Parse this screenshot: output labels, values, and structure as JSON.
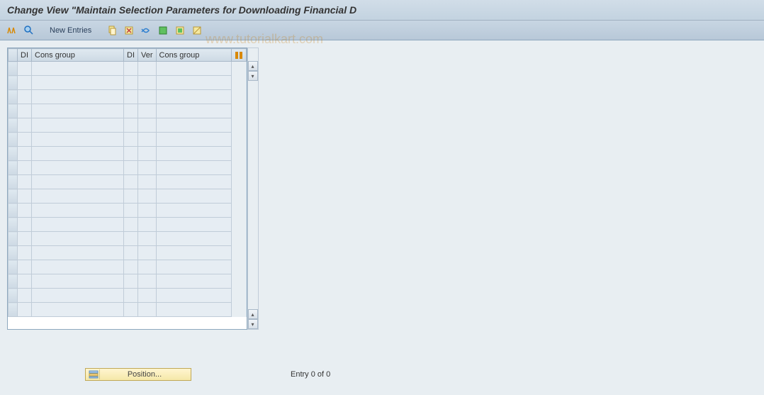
{
  "title": "Change View \"Maintain Selection Parameters for Downloading Financial D",
  "toolbar": {
    "new_entries": "New Entries"
  },
  "table": {
    "headers": {
      "di1": "DI",
      "cons_group1": "Cons group",
      "di2": "DI",
      "ver": "Ver",
      "cons_group2": "Cons group"
    },
    "row_count": 18
  },
  "footer": {
    "position_label": "Position...",
    "entry_text": "Entry 0 of 0"
  },
  "watermark": "www.tutorialkart.com"
}
